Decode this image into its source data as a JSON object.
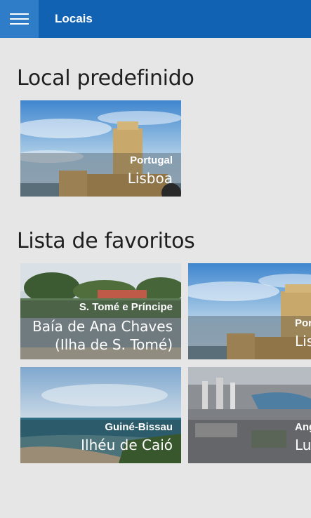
{
  "header": {
    "title": "Locais",
    "menu_icon": "hamburger-menu-icon"
  },
  "default_section": {
    "title": "Local predefinido",
    "tile": {
      "country": "Portugal",
      "place": "Lisboa"
    }
  },
  "favorites_section": {
    "title": "Lista de favoritos",
    "tiles": [
      {
        "country": "S. Tomé e Príncipe",
        "place_line1": "Baía de Ana Chaves",
        "place_line2": "(Ilha de S. Tomé)"
      },
      {
        "country": "Portugal",
        "place": "Lisboa"
      },
      {
        "country": "Guiné-Bissau",
        "place": "Ilhéu de Caió"
      },
      {
        "country": "Angola",
        "place": "Luanda"
      }
    ]
  },
  "colors": {
    "header_bg": "#1262b3",
    "menu_button_bg": "#2f7dc8",
    "page_bg": "#e6e6e6"
  }
}
